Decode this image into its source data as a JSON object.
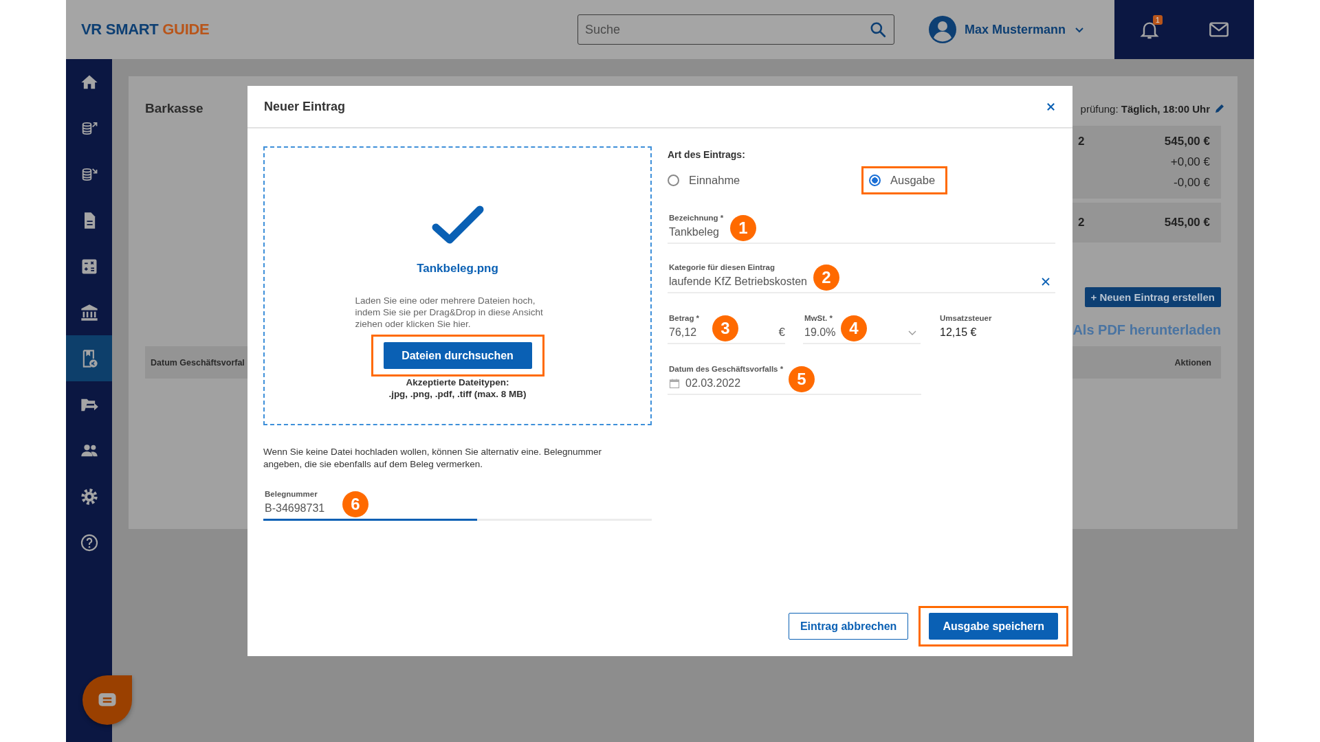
{
  "header": {
    "logo": {
      "primary": "VR SMART",
      "accent": "GUIDE"
    },
    "search": {
      "placeholder": "Suche"
    },
    "user": {
      "name": "Max Mustermann"
    },
    "notifications": {
      "count": "1"
    }
  },
  "sidebar": {
    "items": [
      {
        "kind": "home",
        "selected": false
      },
      {
        "kind": "income",
        "selected": false
      },
      {
        "kind": "expense",
        "selected": false
      },
      {
        "kind": "document",
        "selected": false
      },
      {
        "kind": "calculator",
        "selected": false
      },
      {
        "kind": "bank",
        "selected": false
      },
      {
        "kind": "receipt",
        "selected": true
      },
      {
        "kind": "folder",
        "selected": false
      },
      {
        "kind": "people",
        "selected": false
      },
      {
        "kind": "settings",
        "selected": false
      },
      {
        "kind": "help",
        "selected": false
      }
    ]
  },
  "page": {
    "title": "Barkasse",
    "schedule": "prüfung: **Täglich, 18:00 Uhr**",
    "summary": [
      {
        "column_1": "2",
        "amount": "545,00 €"
      },
      {
        "amount": "+0,00 €"
      },
      {
        "amount": "-0,00 €"
      }
    ],
    "total": {
      "column_1": "2",
      "amount": "545,00 €"
    },
    "new_button": "+ Neuen Eintrag erstellen",
    "pdf_link": "Als PDF herunterladen",
    "table": {
      "columns": [
        "Datum Geschäftsvorfal",
        "Aktionen"
      ]
    }
  },
  "dialog": {
    "title": "Neuer Eintrag",
    "upload": {
      "file_name": "Tankbeleg.png",
      "instructions": "Laden Sie eine oder mehrere Dateien hoch, indem Sie sie per Drag&Drop in diese Ansicht ziehen oder klicken Sie hier.",
      "browse_button": {
        "label": "Dateien durchsuchen",
        "highlighted": true
      },
      "accepted_title": "Akzeptierte Dateitypen:",
      "accepted_types": ".jpg, .png, .pdf, .tiff (max. 8 MB)"
    },
    "note": "Wenn Sie keine Datei hochladen wollen, können Sie alternativ eine. Belegnummer angeben, die sie ebenfalls auf dem Beleg vermerken.",
    "receipt_number": {
      "label": "Belegnummer",
      "value": "B-34698731",
      "step": "6",
      "level": 0.55
    },
    "entry_type": {
      "label": "Art des Eintrags:",
      "options": [
        {
          "label": "Einnahme",
          "selected": false,
          "highlighted": false
        },
        {
          "label": "Ausgabe",
          "selected": true,
          "highlighted": true
        }
      ]
    },
    "fields": [
      {
        "kind": "text",
        "label": "Bezeichnung *",
        "value": "Tankbeleg",
        "step": "1"
      },
      {
        "kind": "clearable",
        "label": "Kategorie für diesen Eintrag",
        "value": "laufende KfZ Betriebskosten",
        "step": "2"
      }
    ],
    "amount": {
      "label": "Betrag *",
      "value": "76,12",
      "unit": "€",
      "step": "3"
    },
    "vat": {
      "label": "MwSt. *",
      "value": "19.0%",
      "step": "4"
    },
    "sales_tax": {
      "label": "Umsatzsteuer",
      "value": "12,15 €"
    },
    "date": {
      "label": "Datum des Geschäftsvorfalls *",
      "value": "02.03.2022",
      "step": "5"
    },
    "buttons": [
      {
        "kind": "secondary",
        "label": "Eintrag abbrechen",
        "highlighted": false
      },
      {
        "kind": "primary",
        "label": "Ausgabe speichern",
        "highlighted": true
      }
    ]
  }
}
